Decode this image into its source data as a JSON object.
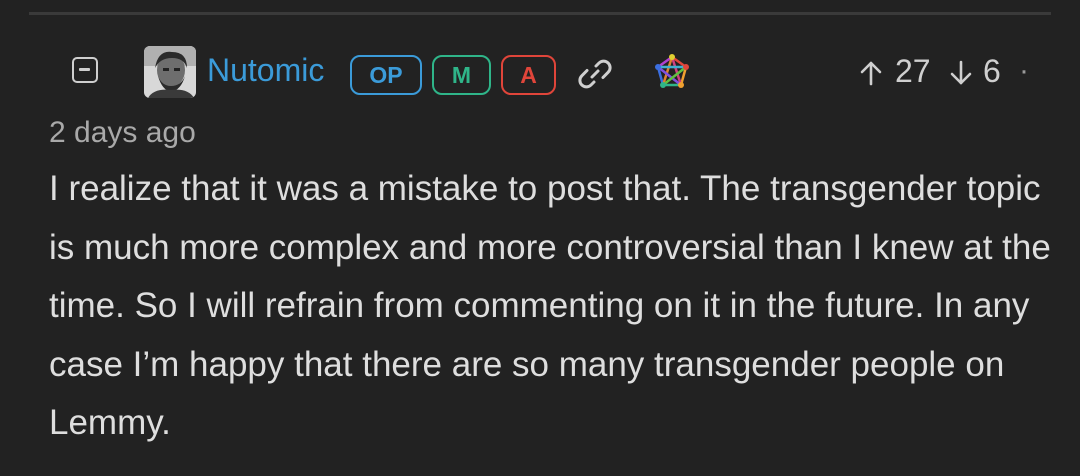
{
  "comment": {
    "author": "Nutomic",
    "badges": {
      "op": "OP",
      "mod": "M",
      "admin": "A"
    },
    "upvotes": "27",
    "downvotes": "6",
    "more": "·",
    "time": "2 days ago",
    "body": "I realize that it was a mistake to post that. The transgender topic is much more complex and more controversial than I knew at the time. So I will refrain from commenting on it in the future. In any case I’m happy that there are so many transgender people on Lemmy."
  },
  "icons": {
    "collapse": "minus-square-icon",
    "link": "link-icon",
    "fediverse": "fediverse-icon",
    "upvote": "arrow-up-icon",
    "downvote": "arrow-down-icon"
  },
  "colors": {
    "background": "#222222",
    "username": "#3b9bd9",
    "op_badge": "#3b9bd9",
    "mod_badge": "#2fb589",
    "admin_badge": "#e0453a",
    "text": "#dedede",
    "muted": "#a9a9a9"
  }
}
